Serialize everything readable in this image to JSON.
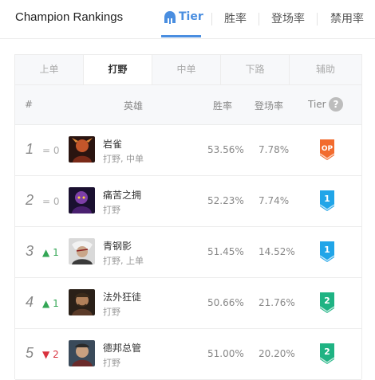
{
  "header": {
    "title": "Champion Rankings",
    "tabs": [
      {
        "label": "Tier",
        "active": true
      },
      {
        "label": "胜率",
        "active": false
      },
      {
        "label": "登场率",
        "active": false
      },
      {
        "label": "禁用率",
        "active": false
      }
    ]
  },
  "positions": [
    "上单",
    "打野",
    "中单",
    "下路",
    "辅助"
  ],
  "active_position": "打野",
  "columns": {
    "rank": "#",
    "champion": "英雄",
    "win_rate": "胜率",
    "pick_rate": "登场率",
    "tier": "Tier",
    "help": "?"
  },
  "rows": [
    {
      "rank": "1",
      "trend_symbol": "=",
      "trend_value": "0",
      "trend": "same",
      "name": "岩雀",
      "roles": "打野, 中单",
      "win_rate": "53.56%",
      "pick_rate": "7.78%",
      "tier": "OP",
      "badge_color": "#f26b2e"
    },
    {
      "rank": "2",
      "trend_symbol": "=",
      "trend_value": "0",
      "trend": "same",
      "name": "痛苦之拥",
      "roles": "打野",
      "win_rate": "52.23%",
      "pick_rate": "7.74%",
      "tier": "1",
      "badge_color": "#21a5e8"
    },
    {
      "rank": "3",
      "trend_symbol": "▲",
      "trend_value": "1",
      "trend": "up",
      "name": "青钢影",
      "roles": "打野, 上单",
      "win_rate": "51.45%",
      "pick_rate": "14.52%",
      "tier": "1",
      "badge_color": "#21a5e8"
    },
    {
      "rank": "4",
      "trend_symbol": "▲",
      "trend_value": "1",
      "trend": "up",
      "name": "法外狂徒",
      "roles": "打野",
      "win_rate": "50.66%",
      "pick_rate": "21.76%",
      "tier": "2",
      "badge_color": "#1fb383"
    },
    {
      "rank": "5",
      "trend_symbol": "▼",
      "trend_value": "2",
      "trend": "down",
      "name": "德邦总管",
      "roles": "打野",
      "win_rate": "51.00%",
      "pick_rate": "20.20%",
      "tier": "2",
      "badge_color": "#1fb383"
    }
  ],
  "colors": {
    "accent": "#4a8ee0",
    "up": "#33a655",
    "down": "#d9333f"
  }
}
